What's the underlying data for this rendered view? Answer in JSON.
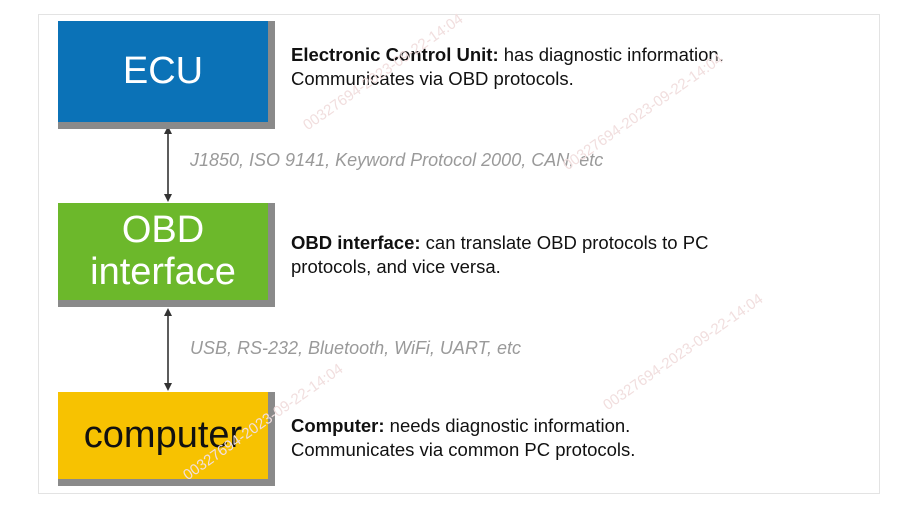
{
  "boxes": {
    "ecu": {
      "label": "ECU",
      "color": "#0b72b7"
    },
    "obd": {
      "label_line1": "OBD",
      "label_line2": "interface",
      "color": "#6cb82b"
    },
    "computer": {
      "label": "computer",
      "color": "#f7c201"
    }
  },
  "descriptions": {
    "ecu": {
      "bold": "Electronic Control Unit:",
      "text": " has diagnostic information.",
      "line2": "Communicates via OBD protocols."
    },
    "obd": {
      "bold": "OBD interface:",
      "text": " can translate OBD protocols to PC",
      "line2": "protocols, and vice versa."
    },
    "computer": {
      "bold": "Computer:",
      "text": " needs diagnostic information.",
      "line2": "Communicates via common PC protocols."
    }
  },
  "protocols": {
    "ecu_obd": "J1850, ISO 9141, Keyword Protocol 2000, CAN, etc",
    "obd_pc": "USB, RS-232, Bluetooth, WiFi, UART, etc"
  },
  "watermark": "00327694-2023-09-22-14:04"
}
